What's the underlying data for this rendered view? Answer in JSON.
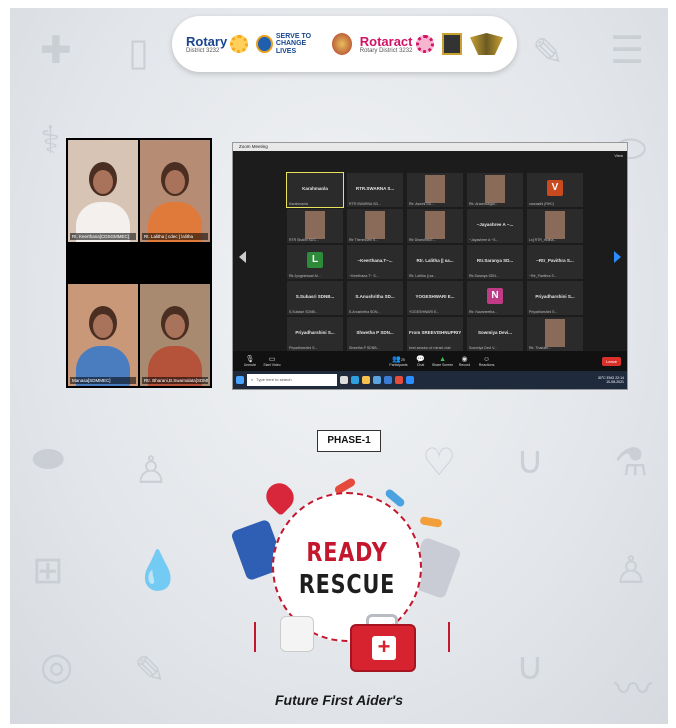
{
  "logos": {
    "rotary_main": "Rotary",
    "rotary_sub": "District 3232",
    "serve_line1": "SERVE TO",
    "serve_line2": "CHANGE LIVES",
    "rotaract_main": "Rotaract",
    "rotaract_sub": "Rotary District 3232"
  },
  "left_cams": [
    {
      "caption": "Rt. Keerthana[CDSGMMEC]"
    },
    {
      "caption": "Rt. Lalitha [ cdec ] lalitha"
    },
    {
      "caption": "Manasa[SDMMEC]"
    },
    {
      "caption": "Rtr. Bharani,B.Swarnalata[SDMMEC]"
    }
  ],
  "zoom": {
    "title": "Zoom Meeting",
    "view_label": "View",
    "tiles": [
      {
        "name": "Karahmanla",
        "sub": "Karahmanla"
      },
      {
        "name": "RTR.SWARNA S...",
        "sub": "RTR.SWARNA SD..."
      },
      {
        "name": "",
        "sub": "Rtr. Aswini SD..."
      },
      {
        "name": "",
        "sub": "Rtr. Aravindaigal..."
      },
      {
        "name": "",
        "sub": "vanuadhi (RHC)"
      },
      {
        "name": "",
        "sub": "RTR Shalini SDC..."
      },
      {
        "name": "",
        "sub": "Rtr Thenmozhi S..."
      },
      {
        "name": "",
        "sub": "Rtr Dharshini.E..."
      },
      {
        "name": "~Jayashree A ~...",
        "sub": "~Jayashree A ~S..."
      },
      {
        "name": "",
        "sub": "Ls[ RTR_mutha..."
      },
      {
        "name": "",
        "sub": "Rtr.Jyogeshwari.M..."
      },
      {
        "name": "~Keerthana.T~...",
        "sub": "~Keerthana.T~ S..."
      },
      {
        "name": "Rtr. Lalitha || sa...",
        "sub": "Rtr. Lalitha || sa..."
      },
      {
        "name": "Rtr.Saranya SD...",
        "sub": "Rtr.Saranya SDN..."
      },
      {
        "name": "~Rtr_Pavithra S...",
        "sub": "~Rtr_Pavithra S..."
      },
      {
        "name": "S.Subasri SDNB...",
        "sub": "S.Subasri SDNB..."
      },
      {
        "name": "S.Anushritha SD...",
        "sub": "S.Anushritha SDN..."
      },
      {
        "name": "YOGESHWARI E...",
        "sub": "YOGESHWARI E..."
      },
      {
        "name": "",
        "sub": "Rtr. Navaneetha..."
      },
      {
        "name": "Priyadharshini S...",
        "sub": "Priyadharshini S..."
      },
      {
        "name": "Priyadharshini S...",
        "sub": "Priyadharshini S..."
      },
      {
        "name": "Shwetha P SDN...",
        "sub": "Shwetha P SDNB..."
      },
      {
        "name": "From SREEVISHNUPRIYA J to Everyone",
        "sub": "best session of rotract club"
      },
      {
        "name": "Sowmiya Devi...",
        "sub": "Sowmiya Devi V..."
      },
      {
        "name": "",
        "sub": "Rtr. Thariani..."
      }
    ],
    "letters": [
      "V",
      "L",
      "N"
    ],
    "controls": [
      "Unmute",
      "Start Video",
      "Participants",
      "Chat",
      "Share Screen",
      "Record",
      "Reactions"
    ],
    "participants_count": "25",
    "end_label": "Leave",
    "search_placeholder": "Type here to search",
    "tray_temp": "30°C",
    "tray_lang": "ENG",
    "tray_time": "22:14",
    "tray_date": "10-08-2021"
  },
  "phase_label": "PHASE-1",
  "emblem": {
    "line1": "READY",
    "line2": "RESCUE"
  },
  "tagline": "Future First Aider's",
  "colors": {
    "rescue_red": "#c4162d",
    "rotary_blue": "#17458f",
    "rotaract_pink": "#d41367",
    "zoom_dark": "#1c1c1c"
  }
}
